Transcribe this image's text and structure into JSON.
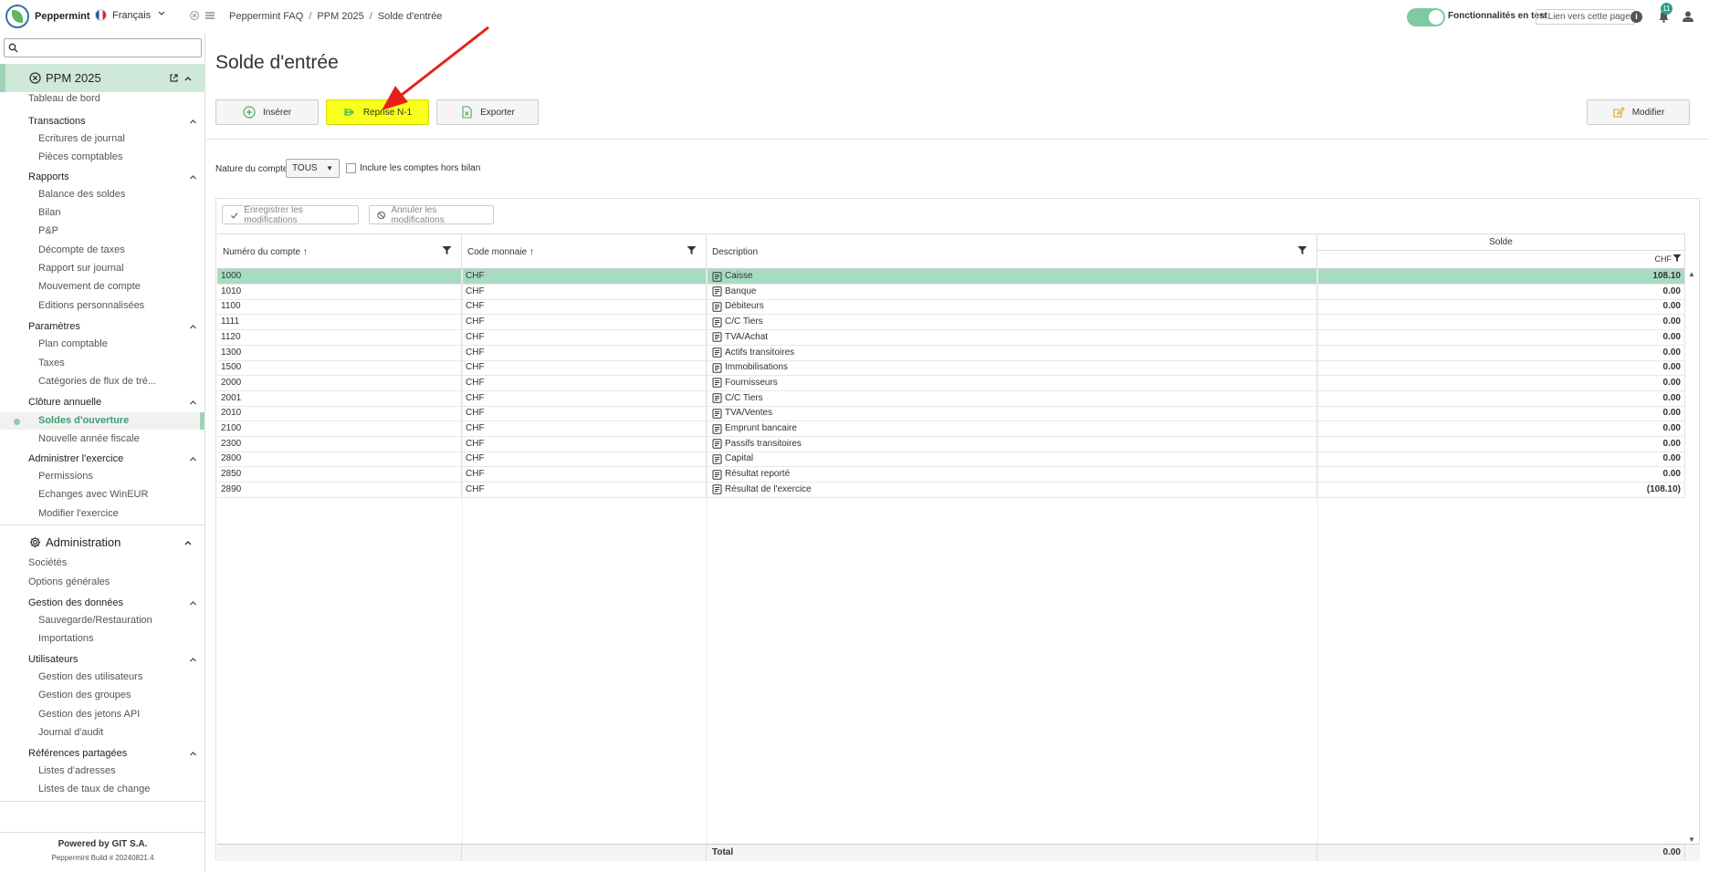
{
  "header": {
    "brand": "Peppermint",
    "language": "Français",
    "breadcrumb": [
      "Peppermint FAQ",
      "PPM 2025",
      "Solde d'entrée"
    ],
    "features_label": "Fonctionnalités en test",
    "link_label": "Lien vers cette page",
    "notifications_count": "11"
  },
  "sidebar": {
    "search_placeholder": "",
    "section_ppm": "PPM 2025",
    "section_admin": "Administration",
    "items": {
      "tableau": "Tableau de bord",
      "g_transactions": "Transactions",
      "ecritures": "Ecritures de journal",
      "pieces": "Pièces comptables",
      "g_rapports": "Rapports",
      "balance": "Balance des soldes",
      "bilan": "Bilan",
      "pp": "P&P",
      "decompte": "Décompte de taxes",
      "rapport_journal": "Rapport sur journal",
      "mouvement": "Mouvement de compte",
      "editions": "Editions personnalisées",
      "g_parametres": "Paramètres",
      "plan": "Plan comptable",
      "taxes": "Taxes",
      "categories": "Catégories de flux de tré...",
      "g_cloture": "Clôture annuelle",
      "soldes": "Soldes d'ouverture",
      "nouvelle": "Nouvelle année fiscale",
      "g_administrer": "Administrer l'exercice",
      "permissions": "Permissions",
      "echanges": "Echanges avec WinEUR",
      "modifier_ex": "Modifier l'exercice",
      "societes": "Sociétés",
      "options": "Options générales",
      "g_gestion": "Gestion des données",
      "sauvegarde": "Sauvegarde/Restauration",
      "importations": "Importations",
      "g_utilisateurs": "Utilisateurs",
      "gestion_users": "Gestion des utilisateurs",
      "gestion_groupes": "Gestion des groupes",
      "gestion_jetons": "Gestion des jetons API",
      "journal_audit": "Journal d'audit",
      "g_references": "Références partagées",
      "listes_adresses": "Listes d'adresses",
      "listes_taux": "Listes de taux de change"
    },
    "footer_powered": "Powered by GIT S.A.",
    "footer_build": "Peppermint Build # 20240821.4"
  },
  "main": {
    "title": "Solde d'entrée",
    "buttons": {
      "insert": "Insérer",
      "reprise": "Reprise N-1",
      "export": "Exporter",
      "modify": "Modifier"
    },
    "filter": {
      "label": "Nature du compte",
      "value": "TOUS",
      "checkbox_label": "Inclure les comptes hors bilan"
    },
    "grid_buttons": {
      "save": "Enregistrer les modifications",
      "cancel": "Annuler les modifications"
    },
    "columns": {
      "num": "Numéro du compte",
      "cur": "Code monnaie",
      "desc": "Description",
      "solde": "Solde",
      "solde_sub": "CHF"
    },
    "rows": [
      {
        "num": "1000",
        "cur": "CHF",
        "desc": "Caisse",
        "solde": "108.10"
      },
      {
        "num": "1010",
        "cur": "CHF",
        "desc": "Banque",
        "solde": "0.00"
      },
      {
        "num": "1100",
        "cur": "CHF",
        "desc": "Débiteurs",
        "solde": "0.00"
      },
      {
        "num": "1111",
        "cur": "CHF",
        "desc": "C/C Tiers",
        "solde": "0.00"
      },
      {
        "num": "1120",
        "cur": "CHF",
        "desc": "TVA/Achat",
        "solde": "0.00"
      },
      {
        "num": "1300",
        "cur": "CHF",
        "desc": "Actifs transitoires",
        "solde": "0.00"
      },
      {
        "num": "1500",
        "cur": "CHF",
        "desc": "Immobilisations",
        "solde": "0.00"
      },
      {
        "num": "2000",
        "cur": "CHF",
        "desc": "Fournisseurs",
        "solde": "0.00"
      },
      {
        "num": "2001",
        "cur": "CHF",
        "desc": "C/C Tiers",
        "solde": "0.00"
      },
      {
        "num": "2010",
        "cur": "CHF",
        "desc": "TVA/Ventes",
        "solde": "0.00"
      },
      {
        "num": "2100",
        "cur": "CHF",
        "desc": "Emprunt bancaire",
        "solde": "0.00"
      },
      {
        "num": "2300",
        "cur": "CHF",
        "desc": "Passifs transitoires",
        "solde": "0.00"
      },
      {
        "num": "2800",
        "cur": "CHF",
        "desc": "Capital",
        "solde": "0.00"
      },
      {
        "num": "2850",
        "cur": "CHF",
        "desc": "Résultat reporté",
        "solde": "0.00"
      },
      {
        "num": "2890",
        "cur": "CHF",
        "desc": "Résultat de l'exercice",
        "solde": "(108.10)"
      }
    ],
    "footer": {
      "label": "Total",
      "value": "0.00"
    }
  },
  "colors": {
    "accent_green": "#9ed4b4",
    "selected_row": "#a8dcc1",
    "highlight_button": "#f8ff1c",
    "annotation_arrow": "#e8201c"
  }
}
